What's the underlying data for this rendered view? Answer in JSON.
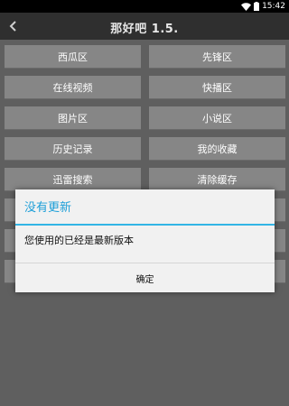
{
  "status_bar": {
    "time": "15:42"
  },
  "header": {
    "title": "那好吧 1.5."
  },
  "menu": {
    "items": [
      [
        "西瓜区",
        "先锋区"
      ],
      [
        "在线视频",
        "快播区"
      ],
      [
        "图片区",
        "小说区"
      ],
      [
        "历史记录",
        "我的收藏"
      ],
      [
        "迅雷搜索",
        "清除缓存"
      ]
    ]
  },
  "dialog": {
    "title": "没有更新",
    "message": "您使用的已经是最新版本",
    "ok_label": "确定"
  },
  "colors": {
    "dialog_accent": "#33b5e5",
    "button_bg": "#868686",
    "title_bar_bg": "#2f2f2f"
  }
}
